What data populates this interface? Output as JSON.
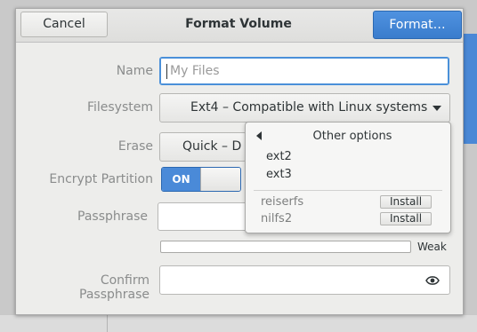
{
  "header": {
    "cancel_label": "Cancel",
    "title": "Format Volume",
    "format_label": "Format…"
  },
  "form": {
    "name_label": "Name",
    "name_value": "",
    "name_placeholder": "My Files",
    "filesystem_label": "Filesystem",
    "filesystem_value": "Ext4 –   Compatible with Linux systems",
    "erase_label": "Erase",
    "erase_value": "Quick –  D",
    "encrypt_label": "Encrypt Partition",
    "encrypt_state": "ON",
    "passphrase_label": "Passphrase",
    "passphrase_value": "",
    "strength_label": "Weak",
    "confirm_label": "Confirm Passphrase",
    "confirm_value": ""
  },
  "popover": {
    "title": "Other options",
    "items": [
      "ext2",
      "ext3"
    ],
    "installable": [
      {
        "name": "reiserfs",
        "action": "Install"
      },
      {
        "name": "nilfs2",
        "action": "Install"
      }
    ]
  },
  "icons": {
    "back": "chevron-left-icon",
    "dropdown": "chevron-down-icon",
    "reveal": "eye-icon"
  },
  "colors": {
    "accent": "#4a8ad8",
    "dialog_bg": "#ededeb"
  }
}
